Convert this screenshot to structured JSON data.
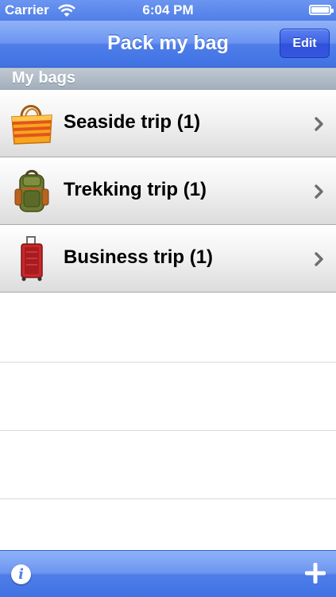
{
  "status_bar": {
    "carrier": "Carrier",
    "time": "6:04 PM"
  },
  "nav": {
    "title": "Pack my bag",
    "edit_label": "Edit"
  },
  "section": {
    "title": "My bags"
  },
  "bags": [
    {
      "label": "Seaside trip (1)",
      "icon": "beach-bag-icon"
    },
    {
      "label": "Trekking trip (1)",
      "icon": "backpack-icon"
    },
    {
      "label": "Business trip (1)",
      "icon": "suitcase-icon"
    }
  ],
  "toolbar": {
    "info_glyph": "i",
    "add_icon": "plus-icon"
  },
  "colors": {
    "bar_blue": "#4f7ee8",
    "edit_button": "#3556df",
    "section_gray": "#a2afbc"
  }
}
